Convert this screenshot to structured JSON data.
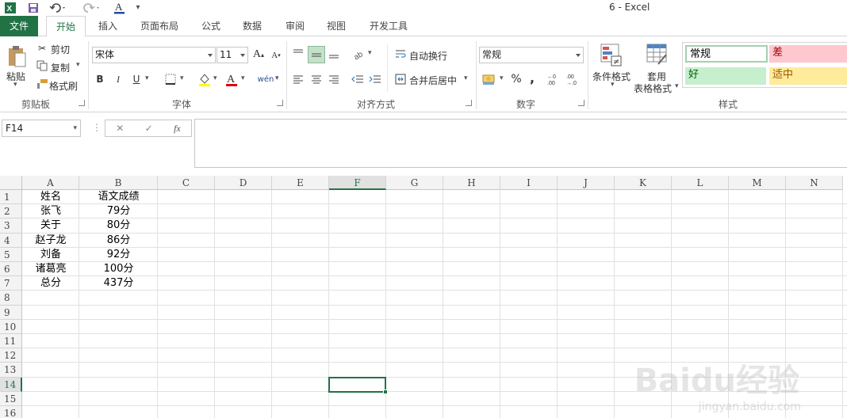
{
  "window": {
    "title": "6 - Excel"
  },
  "tabs": [
    {
      "label": "文件"
    },
    {
      "label": "开始"
    },
    {
      "label": "插入"
    },
    {
      "label": "页面布局"
    },
    {
      "label": "公式"
    },
    {
      "label": "数据"
    },
    {
      "label": "审阅"
    },
    {
      "label": "视图"
    },
    {
      "label": "开发工具"
    }
  ],
  "ribbon": {
    "clipboard": {
      "paste": "粘贴",
      "cut": "剪切",
      "copy": "复制",
      "format_painter": "格式刷",
      "group": "剪贴板"
    },
    "font": {
      "name": "宋体",
      "size": "11",
      "group": "字体",
      "bold": "B",
      "italic": "I",
      "underline": "U",
      "grow": "A",
      "shrink": "A",
      "font_color_letter": "A",
      "phonetic": "wén"
    },
    "alignment": {
      "wrap": "自动换行",
      "merge": "合并后居中",
      "group": "对齐方式"
    },
    "number": {
      "format": "常规",
      "percent": "%",
      "comma": ",",
      "group": "数字"
    },
    "styles": {
      "conditional": "条件格式",
      "table_line1": "套用",
      "table_line2": "表格格式",
      "normal": "常规",
      "bad": "差",
      "good": "好",
      "neutral": "适中",
      "group": "样式"
    }
  },
  "formula_bar": {
    "name_box": "F14",
    "content": "",
    "fx": "fx"
  },
  "columns": [
    "A",
    "B",
    "C",
    "D",
    "E",
    "F",
    "G",
    "H",
    "I",
    "J",
    "K",
    "L",
    "M",
    "N"
  ],
  "rows": [
    "1",
    "2",
    "3",
    "4",
    "5",
    "6",
    "7",
    "8",
    "9",
    "10",
    "11",
    "12",
    "13",
    "14",
    "15",
    "16"
  ],
  "sheet": {
    "A": [
      "姓名",
      "张飞",
      "关于",
      "赵子龙",
      "刘备",
      "诸葛亮",
      "总分"
    ],
    "B": [
      "语文成绩",
      "79分",
      "80分",
      "86分",
      "92分",
      "100分",
      "437分"
    ]
  },
  "selected_cell": "F14",
  "watermark": {
    "brand": "Baidu经验",
    "url": "jingyan.baidu.com"
  },
  "colors": {
    "accent": "#217346",
    "bad_bg": "#ffc7ce",
    "bad_fg": "#9c0006",
    "good_bg": "#c6efce",
    "good_fg": "#006100",
    "neutral_bg": "#ffeb9c",
    "neutral_fg": "#9c5700"
  }
}
